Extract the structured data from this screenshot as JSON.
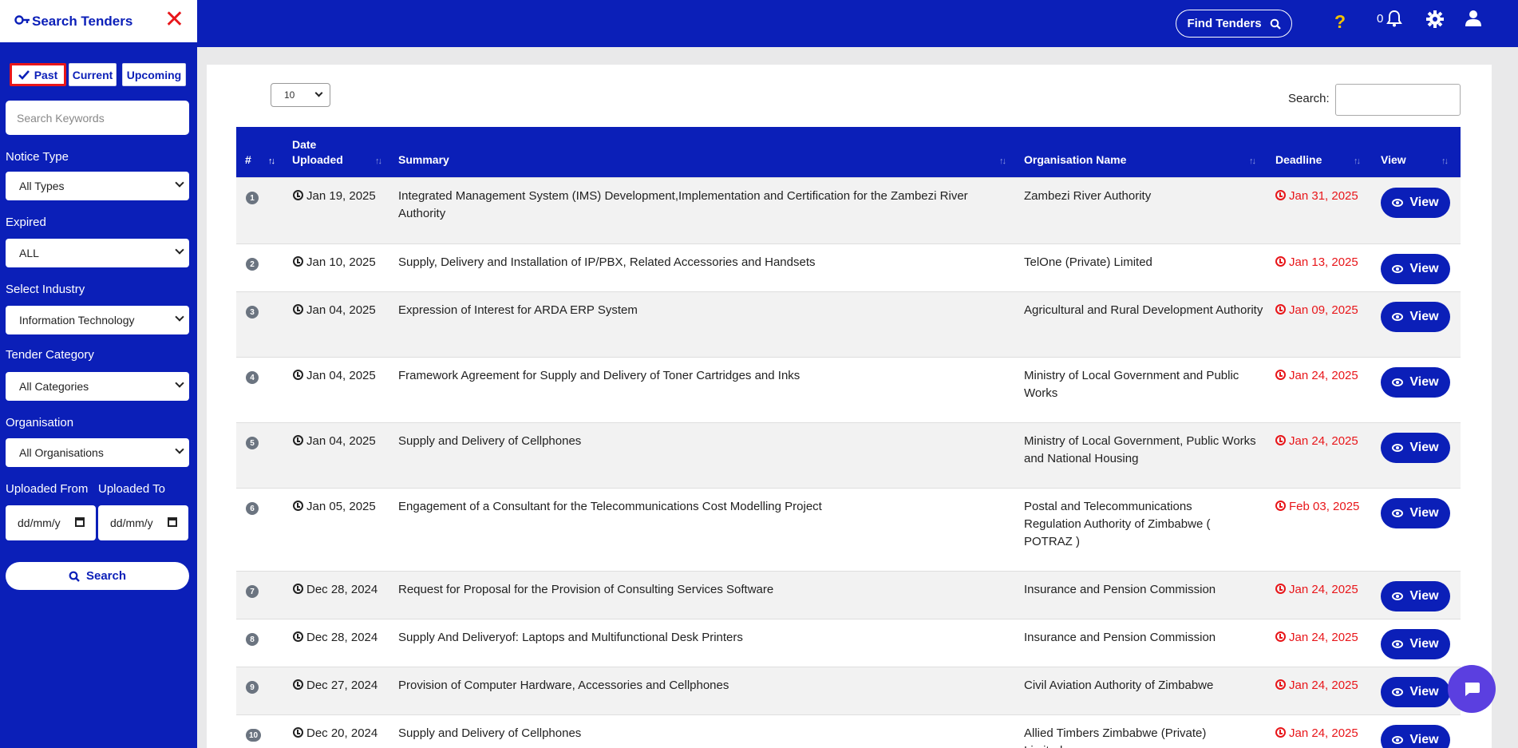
{
  "sidebar": {
    "title": "Search Tenders",
    "close_glyph": "✕",
    "tabs": {
      "past": "Past",
      "current": "Current",
      "upcoming": "Upcoming"
    },
    "keyword_placeholder": "Search Keywords",
    "notice_type": {
      "label": "Notice Type",
      "value": "All Types"
    },
    "expired": {
      "label": "Expired",
      "value": "ALL"
    },
    "industry": {
      "label": "Select Industry",
      "value": "Information Technology"
    },
    "category": {
      "label": "Tender Category",
      "value": "All Categories"
    },
    "organisation": {
      "label": "Organisation",
      "value": "All Organisations"
    },
    "uploaded_from": {
      "label": "Uploaded From",
      "value": "dd/mm/y"
    },
    "uploaded_to": {
      "label": "Uploaded To",
      "value": "dd/mm/y"
    },
    "search_button": "Search"
  },
  "topbar": {
    "find_tenders": "Find Tenders",
    "help_glyph": "?",
    "notification_count": "0",
    "icons": [
      "bell-icon",
      "gear-icon",
      "user-icon"
    ]
  },
  "table_controls": {
    "length_value": "10",
    "search_label": "Search:"
  },
  "table": {
    "headers": {
      "num": "#",
      "date_line1": "Date",
      "date_line2": "Uploaded",
      "summary": "Summary",
      "org": "Organisation Name",
      "deadline": "Deadline",
      "view": "View"
    },
    "rows": [
      {
        "num": "1",
        "date": "Jan 19, 2025",
        "summary": "Integrated Management System (IMS) Development,Implementation and Certification for the Zambezi River Authority",
        "org": "Zambezi River Authority",
        "deadline": "Jan 31, 2025",
        "view": "View"
      },
      {
        "num": "2",
        "date": "Jan 10, 2025",
        "summary": "Supply, Delivery and Installation of IP/PBX, Related Accessories and Handsets",
        "org": "TelOne (Private) Limited",
        "deadline": "Jan 13, 2025",
        "view": "View"
      },
      {
        "num": "3",
        "date": "Jan 04, 2025",
        "summary": "Expression of Interest for ARDA ERP System",
        "org": "Agricultural and Rural Development Authority",
        "deadline": "Jan 09, 2025",
        "view": "View"
      },
      {
        "num": "4",
        "date": "Jan 04, 2025",
        "summary": "Framework Agreement for Supply and Delivery of Toner Cartridges and Inks",
        "org": "Ministry of Local Government and Public Works",
        "deadline": "Jan 24, 2025",
        "view": "View"
      },
      {
        "num": "5",
        "date": "Jan 04, 2025",
        "summary": "Supply and Delivery of Cellphones",
        "org": "Ministry of Local Government, Public Works and National Housing",
        "deadline": "Jan 24, 2025",
        "view": "View"
      },
      {
        "num": "6",
        "date": "Jan 05, 2025",
        "summary": "Engagement of a Consultant for the Telecommunications Cost Modelling Project",
        "org": "Postal and Telecommunications Regulation Authority of Zimbabwe ( POTRAZ )",
        "deadline": "Feb 03, 2025",
        "view": "View"
      },
      {
        "num": "7",
        "date": "Dec 28, 2024",
        "summary": "Request for Proposal for the Provision of Consulting Services Software",
        "org": "Insurance and Pension Commission",
        "deadline": "Jan 24, 2025",
        "view": "View"
      },
      {
        "num": "8",
        "date": "Dec 28, 2024",
        "summary": "Supply And Deliveryof: Laptops and Multifunctional Desk Printers",
        "org": "Insurance and Pension Commission",
        "deadline": "Jan 24, 2025",
        "view": "View"
      },
      {
        "num": "9",
        "date": "Dec 27, 2024",
        "summary": "Provision of Computer Hardware, Accessories and Cellphones",
        "org": "Civil Aviation Authority of Zimbabwe",
        "deadline": "Jan 24, 2025",
        "view": "View"
      },
      {
        "num": "10",
        "date": "Dec 20, 2024",
        "summary": "Supply and Delivery of Cellphones",
        "org": "Allied Timbers Zimbabwe (Private) Limited",
        "deadline": "Jan 24, 2025",
        "view": "View"
      }
    ]
  },
  "colors": {
    "brand_blue": "#0b1fb8",
    "deadline_red": "#e8161a",
    "help_yellow": "#f2c200",
    "chat_purple": "#5b3fe0"
  }
}
